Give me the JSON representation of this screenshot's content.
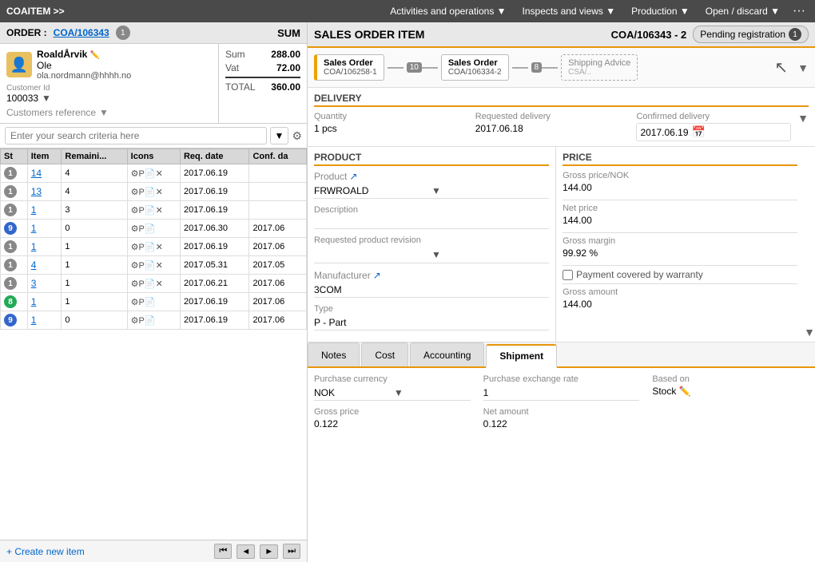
{
  "topNav": {
    "breadcrumb": "COAITEM >>",
    "links": [
      {
        "label": "Activities and operations ▼",
        "key": "activities"
      },
      {
        "label": "Inspects and views ▼",
        "key": "inspects"
      },
      {
        "label": "Production ▼",
        "key": "production"
      },
      {
        "label": "Open / discard ▼",
        "key": "open"
      },
      {
        "label": "···",
        "key": "more"
      }
    ]
  },
  "leftPanel": {
    "orderLabel": "ORDER :",
    "orderNum": "COA/106343",
    "orderBadge": "1",
    "sumLabel": "SUM",
    "customer": {
      "name": "RoaldÅrvik",
      "subname": "Ole",
      "email": "ola.nordmann@hhhh.no",
      "customerIdLabel": "Customer Id",
      "customerId": "100033",
      "refLabel": "Customers reference"
    },
    "sum": {
      "sumLabel": "Sum",
      "sumValue": "288.00",
      "vatLabel": "Vat",
      "vatValue": "72.00",
      "totalLabel": "TOTAL",
      "totalValue": "360.00"
    },
    "searchPlaceholder": "Enter your search criteria here",
    "tableHeaders": [
      "St",
      "Item",
      "Remaini...",
      "Icons",
      "Req. date",
      "Conf. da"
    ],
    "tableRows": [
      {
        "st": "1",
        "stType": "1",
        "item": "14",
        "remaining": "4",
        "reqDate": "2017.06.19",
        "confDate": "",
        "hasX": true
      },
      {
        "st": "1",
        "stType": "1",
        "item": "13",
        "remaining": "4",
        "reqDate": "2017.06.19",
        "confDate": "",
        "hasX": true
      },
      {
        "st": "1",
        "stType": "1",
        "item": "1",
        "remaining": "3",
        "reqDate": "2017.06.19",
        "confDate": "",
        "hasX": true
      },
      {
        "st": "9",
        "stType": "9",
        "item": "1",
        "remaining": "0",
        "reqDate": "2017.06.30",
        "confDate": "2017.06",
        "hasX": false
      },
      {
        "st": "1",
        "stType": "1",
        "item": "1",
        "remaining": "1",
        "reqDate": "2017.06.19",
        "confDate": "2017.06",
        "hasX": true
      },
      {
        "st": "1",
        "stType": "1",
        "item": "4",
        "remaining": "1",
        "reqDate": "2017.05.31",
        "confDate": "2017.05",
        "hasX": true
      },
      {
        "st": "1",
        "stType": "1",
        "item": "3",
        "remaining": "1",
        "reqDate": "2017.06.21",
        "confDate": "2017.06",
        "hasX": true
      },
      {
        "st": "8",
        "stType": "8",
        "item": "1",
        "remaining": "1",
        "reqDate": "2017.06.19",
        "confDate": "2017.06",
        "hasX": false
      },
      {
        "st": "9",
        "stType": "9",
        "item": "1",
        "remaining": "0",
        "reqDate": "2017.06.19",
        "confDate": "2017.06",
        "hasX": false
      }
    ],
    "addNewLabel": "+ Create new item",
    "pagination": {
      "firstBtn": "⏮",
      "prevBtn": "◄",
      "nextBtn": "►",
      "lastBtn": "⏭"
    }
  },
  "rightPanel": {
    "title": "SALES ORDER ITEM",
    "docId": "COA/106343 - 2",
    "pendingLabel": "Pending registration",
    "pendingCount": "1",
    "workflow": [
      {
        "line1": "Sales Order",
        "line2": "COA/106258-1",
        "badge": "",
        "active": true
      },
      {
        "badge": "10"
      },
      {
        "line1": "Sales Order",
        "line2": "COA/106334-2",
        "badge": ""
      },
      {
        "badge": "8"
      },
      {
        "line1": "Shipping Advice",
        "line2": "CSA/..",
        "dashed": true
      }
    ],
    "delivery": {
      "sectionTitle": "DELIVERY",
      "quantityLabel": "Quantity",
      "quantityValue": "1 pcs",
      "reqDeliveryLabel": "Requested delivery",
      "reqDeliveryValue": "2017.06.18",
      "confDeliveryLabel": "Confirmed delivery",
      "confDeliveryValue": "2017.06.19"
    },
    "product": {
      "sectionTitle": "PRODUCT",
      "productLabel": "Product",
      "productValue": "FRWROALD",
      "descriptionLabel": "Description",
      "descriptionValue": "",
      "reqRevisionLabel": "Requested product revision",
      "reqRevisionValue": "",
      "manufacturerLabel": "Manufacturer",
      "manufacturerValue": "3COM",
      "typeLabel": "Type",
      "typeValue": "P - Part"
    },
    "price": {
      "sectionTitle": "PRICE",
      "grossPriceLabel": "Gross price/NOK",
      "grossPriceValue": "144.00",
      "netPriceLabel": "Net price",
      "netPriceValue": "144.00",
      "grossMarginLabel": "Gross margin",
      "grossMarginValue": "99.92 %",
      "paymentWarrantyLabel": "Payment covered by warranty",
      "grossAmountLabel": "Gross amount",
      "grossAmountValue": "144.00"
    },
    "tabs": [
      {
        "label": "Notes",
        "key": "notes",
        "active": false
      },
      {
        "label": "Cost",
        "key": "cost",
        "active": false
      },
      {
        "label": "Accounting",
        "key": "accounting",
        "active": false
      },
      {
        "label": "Shipment",
        "key": "shipment",
        "active": true
      }
    ],
    "tabContent": {
      "purchaseCurrencyLabel": "Purchase currency",
      "purchaseCurrencyValue": "NOK",
      "purchaseExchangeRateLabel": "Purchase exchange rate",
      "purchaseExchangeRateValue": "1",
      "basedOnLabel": "Based on",
      "basedOnValue": "Stock",
      "grossPriceLabel": "Gross price",
      "grossPriceValue": "0.122",
      "netAmountLabel": "Net amount",
      "netAmountValue": "0.122"
    }
  }
}
